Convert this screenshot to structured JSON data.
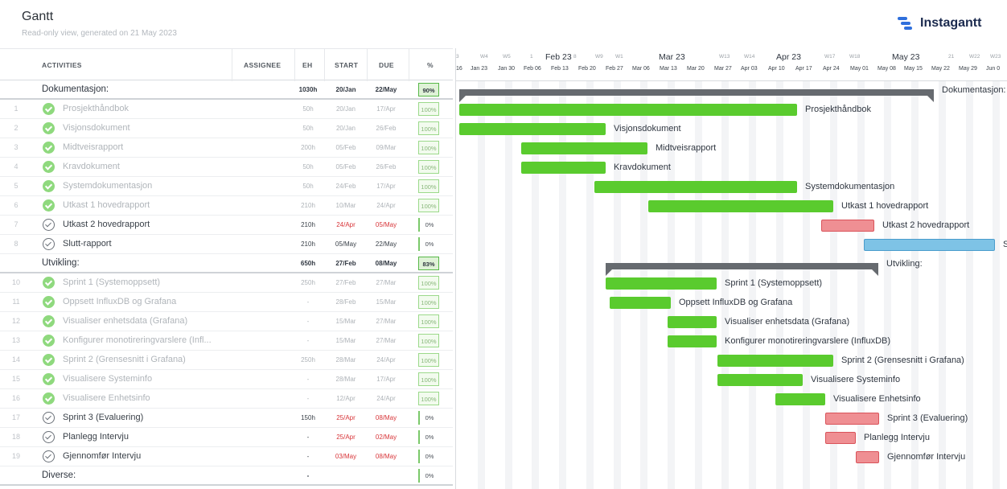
{
  "header": {
    "title": "Gantt",
    "subtitle": "Read-only view, generated on 21 May 2023",
    "brand": "Instagantt",
    "brand_color": "#2f6fdc"
  },
  "columns": {
    "activities": "ACTIVITIES",
    "assignee": "ASSIGNEE",
    "eh": "EH",
    "start": "START",
    "due": "DUE",
    "pct": "%"
  },
  "timeline": {
    "top_labels": [
      "3",
      "W4",
      "W5",
      "1",
      "8",
      "W9",
      "W1",
      "W13",
      "W14",
      "W17",
      "W18",
      "21",
      "W22",
      "W23"
    ],
    "months": [
      "Feb 23",
      "Mar 23",
      "Apr 23",
      "May 23"
    ],
    "weeks": [
      "16",
      "Jan 23",
      "Jan 30",
      "Feb 06",
      "Feb 13",
      "Feb 20",
      "Feb 27",
      "Mar 06",
      "Mar 13",
      "Mar 20",
      "Mar 27",
      "Apr 03",
      "Apr 10",
      "Apr 17",
      "Apr 24",
      "May 01",
      "May 08",
      "May 15",
      "May 22",
      "May 29",
      "Jun 0"
    ]
  },
  "rows": [
    {
      "num": "",
      "name": "Dokumentasjon:",
      "type": "group",
      "eh": "1030h",
      "start": "20/Jan",
      "due": "22/May",
      "pct": "90%"
    },
    {
      "num": "1",
      "name": "Prosjekthåndbok",
      "type": "done",
      "eh": "50h",
      "start": "20/Jan",
      "due": "17/Apr",
      "pct": "100%"
    },
    {
      "num": "2",
      "name": "Visjonsdokument",
      "type": "done",
      "eh": "50h",
      "start": "20/Jan",
      "due": "26/Feb",
      "pct": "100%"
    },
    {
      "num": "3",
      "name": "Midtveisrapport",
      "type": "done",
      "eh": "200h",
      "start": "05/Feb",
      "due": "09/Mar",
      "pct": "100%"
    },
    {
      "num": "4",
      "name": "Kravdokument",
      "type": "done",
      "eh": "50h",
      "start": "05/Feb",
      "due": "26/Feb",
      "pct": "100%"
    },
    {
      "num": "5",
      "name": "Systemdokumentasjon",
      "type": "done",
      "eh": "50h",
      "start": "24/Feb",
      "due": "17/Apr",
      "pct": "100%"
    },
    {
      "num": "6",
      "name": "Utkast 1 hovedrapport",
      "type": "done",
      "eh": "210h",
      "start": "10/Mar",
      "due": "24/Apr",
      "pct": "100%"
    },
    {
      "num": "7",
      "name": "Utkast 2 hovedrapport",
      "type": "todo",
      "eh": "210h",
      "start": "24/Apr",
      "due": "05/May",
      "pct": "0%",
      "late": true
    },
    {
      "num": "8",
      "name": "Slutt-rapport",
      "type": "todo",
      "eh": "210h",
      "start": "05/May",
      "due": "22/May",
      "pct": "0%"
    },
    {
      "num": "",
      "name": "Utvikling:",
      "type": "group",
      "eh": "650h",
      "start": "27/Feb",
      "due": "08/May",
      "pct": "83%"
    },
    {
      "num": "10",
      "name": "Sprint 1 (Systemoppsett)",
      "type": "done",
      "eh": "250h",
      "start": "27/Feb",
      "due": "27/Mar",
      "pct": "100%"
    },
    {
      "num": "11",
      "name": "Oppsett InfluxDB og Grafana",
      "type": "done",
      "eh": "-",
      "start": "28/Feb",
      "due": "15/Mar",
      "pct": "100%"
    },
    {
      "num": "12",
      "name": "Visualiser enhetsdata (Grafana)",
      "type": "done",
      "eh": "-",
      "start": "15/Mar",
      "due": "27/Mar",
      "pct": "100%"
    },
    {
      "num": "13",
      "name": "Konfigurer monotireringvarslere (Infl...",
      "type": "done",
      "eh": "-",
      "start": "15/Mar",
      "due": "27/Mar",
      "pct": "100%"
    },
    {
      "num": "14",
      "name": "Sprint 2 (Grensesnitt i Grafana)",
      "type": "done",
      "eh": "250h",
      "start": "28/Mar",
      "due": "24/Apr",
      "pct": "100%"
    },
    {
      "num": "15",
      "name": "Visualisere Systeminfo",
      "type": "done",
      "eh": "-",
      "start": "28/Mar",
      "due": "17/Apr",
      "pct": "100%"
    },
    {
      "num": "16",
      "name": "Visualisere Enhetsinfo",
      "type": "done",
      "eh": "-",
      "start": "12/Apr",
      "due": "24/Apr",
      "pct": "100%"
    },
    {
      "num": "17",
      "name": "Sprint 3 (Evaluering)",
      "type": "todo",
      "eh": "150h",
      "start": "25/Apr",
      "due": "08/May",
      "pct": "0%",
      "late": true
    },
    {
      "num": "18",
      "name": "Planlegg Intervju",
      "type": "todo",
      "eh": "-",
      "start": "25/Apr",
      "due": "02/May",
      "pct": "0%",
      "late": true
    },
    {
      "num": "19",
      "name": "Gjennomfør Intervju",
      "type": "todo",
      "eh": "-",
      "start": "03/May",
      "due": "08/May",
      "pct": "0%",
      "late": true
    },
    {
      "num": "",
      "name": "Diverse:",
      "type": "group",
      "eh": "-",
      "start": "",
      "due": "",
      "pct": "0%"
    }
  ],
  "bars": [
    {
      "kind": "summary",
      "label": "Dokumentasjon:"
    },
    {
      "kind": "green",
      "label": "Prosjekthåndbok"
    },
    {
      "kind": "green",
      "label": "Visjonsdokument"
    },
    {
      "kind": "green",
      "label": "Midtveisrapport"
    },
    {
      "kind": "green",
      "label": "Kravdokument"
    },
    {
      "kind": "green",
      "label": "Systemdokumentasjon"
    },
    {
      "kind": "green",
      "label": "Utkast 1 hovedrapport"
    },
    {
      "kind": "red",
      "label": "Utkast 2 hovedrapport"
    },
    {
      "kind": "blue",
      "label": "Slutt-rapport"
    },
    {
      "kind": "summary",
      "label": "Utvikling:"
    },
    {
      "kind": "green",
      "label": "Sprint 1 (Systemoppsett)"
    },
    {
      "kind": "green",
      "label": "Oppsett InfluxDB og Grafana"
    },
    {
      "kind": "green",
      "label": "Visualiser enhetsdata (Grafana)"
    },
    {
      "kind": "green",
      "label": "Konfigurer monotireringvarslere (InfluxDB)"
    },
    {
      "kind": "green",
      "label": "Sprint 2 (Grensesnitt i Grafana)"
    },
    {
      "kind": "green",
      "label": "Visualisere Systeminfo"
    },
    {
      "kind": "green",
      "label": "Visualisere Enhetsinfo"
    },
    {
      "kind": "red",
      "label": "Sprint 3 (Evaluering)"
    },
    {
      "kind": "red",
      "label": "Planlegg Intervju"
    },
    {
      "kind": "red",
      "label": "Gjennomfør Intervju"
    }
  ]
}
